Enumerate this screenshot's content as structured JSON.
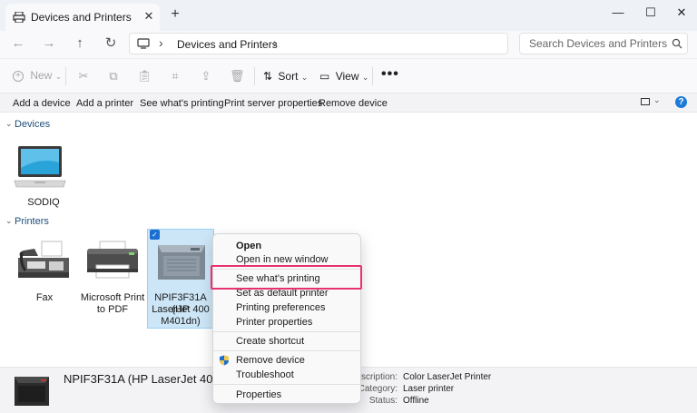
{
  "window": {
    "tab_title": "Devices and Printers",
    "tab_close": "✕",
    "new_tab": "+",
    "minimize": "—",
    "maximize": "☐",
    "close": "✕"
  },
  "address": {
    "back": "←",
    "forward": "→",
    "up": "↑",
    "refresh": "↻",
    "separator": "›",
    "crumb": "Devices and Printers",
    "search_placeholder": "Search Devices and Printers"
  },
  "command_bar": {
    "new_label": "New",
    "sort_label": "Sort",
    "view_label": "View",
    "more": "•••",
    "chevron": "⌄"
  },
  "tasks": [
    "Add a device",
    "Add a printer",
    "See what's printing",
    "Print server properties",
    "Remove device"
  ],
  "help": "?",
  "groups": {
    "devices_header": "Devices",
    "printers_header": "Printers",
    "chevron": "⌄"
  },
  "devices": [
    {
      "label": "SODIQ",
      "icon": "laptop-icon"
    }
  ],
  "printers": [
    {
      "label_lines": [
        "Fax"
      ],
      "icon": "fax-icon"
    },
    {
      "label_lines": [
        "Microsoft Print",
        "to PDF"
      ],
      "icon": "pdf-printer-icon"
    },
    {
      "label_lines": [
        "NPIF3F31A (HP",
        "LaserJet 400",
        "M401dn)"
      ],
      "icon": "laser-printer-icon",
      "selected": true
    }
  ],
  "checkmark": "✓",
  "details": {
    "name": "NPIF3F31A (HP LaserJet 400 M401dn)",
    "fields": [
      {
        "key": "Description:",
        "value": "Color LaserJet Printer"
      },
      {
        "key": "Category:",
        "value": "Laser printer"
      },
      {
        "key": "Status:",
        "value": "Offline"
      }
    ]
  },
  "context_menu": {
    "items": [
      "Open",
      "Open in new window",
      "See what's printing",
      "Set as default printer",
      "Printing preferences",
      "Printer properties",
      "Create shortcut",
      "Remove device",
      "Troubleshoot",
      "Properties"
    ],
    "default_item": "Open",
    "highlighted_item": "See what's printing"
  },
  "colors": {
    "accent": "#1c6fd1",
    "highlight_box": "#e8326f",
    "selection": "#cde6f7",
    "group_header": "#1f4e79"
  }
}
